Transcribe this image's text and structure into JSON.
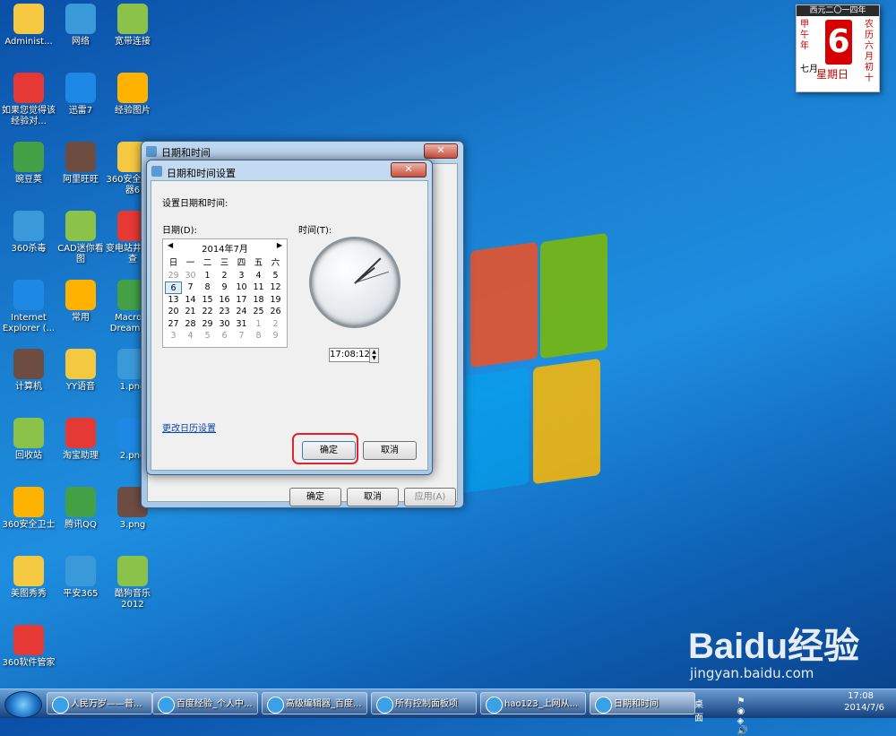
{
  "desktop": {
    "icons": [
      {
        "label": "Administ...",
        "icon": "user-folder-icon"
      },
      {
        "label": "网络",
        "icon": "network-icon"
      },
      {
        "label": "宽带连接",
        "icon": "broadband-icon"
      },
      {
        "label": "如果您觉得该经验对...",
        "icon": "document-icon"
      },
      {
        "label": "迅雷7",
        "icon": "thunder-icon"
      },
      {
        "label": "经验图片",
        "icon": "folder-icon"
      },
      {
        "label": "豌豆荚",
        "icon": "wandoujia-icon"
      },
      {
        "label": "阿里旺旺",
        "icon": "aliwangwang-icon"
      },
      {
        "label": "360安全浏览器6",
        "icon": "360-browser-icon"
      },
      {
        "label": "360杀毒",
        "icon": "360-antivirus-icon"
      },
      {
        "label": "CAD迷你看图",
        "icon": "cad-viewer-icon"
      },
      {
        "label": "变电站井前检查",
        "icon": "winrar-icon"
      },
      {
        "label": "Internet Explorer (...",
        "icon": "ie-icon"
      },
      {
        "label": "常用",
        "icon": "folder-icon"
      },
      {
        "label": "Macrom Dreamw...",
        "icon": "dreamweaver-icon"
      },
      {
        "label": "计算机",
        "icon": "computer-icon"
      },
      {
        "label": "YY语音",
        "icon": "yy-icon"
      },
      {
        "label": "1.png",
        "icon": "image-file-icon"
      },
      {
        "label": "回收站",
        "icon": "recycle-bin-icon"
      },
      {
        "label": "淘宝助理",
        "icon": "taobao-icon"
      },
      {
        "label": "2.png",
        "icon": "image-file-icon"
      },
      {
        "label": "360安全卫士",
        "icon": "360-safe-icon"
      },
      {
        "label": "腾讯QQ",
        "icon": "qq-icon"
      },
      {
        "label": "3.png",
        "icon": "image-file-icon"
      },
      {
        "label": "美图秀秀",
        "icon": "meitu-icon"
      },
      {
        "label": "平安365",
        "icon": "folder-icon"
      },
      {
        "label": "酷狗音乐 2012",
        "icon": "kugou-icon"
      },
      {
        "label": "360软件管家",
        "icon": "360-software-icon"
      }
    ]
  },
  "calendar_widget": {
    "top": "西元二〇一四年",
    "day": "6",
    "left_text": "甲午年",
    "right_text": "农历六月初十",
    "month": "七月",
    "weekday": "星期日"
  },
  "outer_window": {
    "title": "日期和时间",
    "ok": "确定",
    "cancel": "取消",
    "apply": "应用(A)"
  },
  "inner_window": {
    "title": "日期和时间设置",
    "instruction": "设置日期和时间:",
    "date_label": "日期(D):",
    "time_label": "时间(T):",
    "month_header": "2014年7月",
    "weekdays": [
      "日",
      "一",
      "二",
      "三",
      "四",
      "五",
      "六"
    ],
    "weeks": [
      [
        "29",
        "30",
        "1",
        "2",
        "3",
        "4",
        "5"
      ],
      [
        "6",
        "7",
        "8",
        "9",
        "10",
        "11",
        "12"
      ],
      [
        "13",
        "14",
        "15",
        "16",
        "17",
        "18",
        "19"
      ],
      [
        "20",
        "21",
        "22",
        "23",
        "24",
        "25",
        "26"
      ],
      [
        "27",
        "28",
        "29",
        "30",
        "31",
        "1",
        "2"
      ],
      [
        "3",
        "4",
        "5",
        "6",
        "7",
        "8",
        "9"
      ]
    ],
    "selected_day": "6",
    "time_value": "17:08:12",
    "change_calendar_link": "更改日历设置",
    "ok": "确定",
    "cancel": "取消"
  },
  "taskbar": {
    "items": [
      {
        "label": "人民万岁——普..."
      },
      {
        "label": "百度经验_个人中..."
      },
      {
        "label": "高级编辑器_百度..."
      },
      {
        "label": "所有控制面板项"
      },
      {
        "label": "hao123_上网从..."
      },
      {
        "label": "日期和时间"
      }
    ],
    "desktop_label": "桌面",
    "time": "17:08",
    "date": "2014/7/6"
  },
  "watermark": {
    "brand": "Baidu经验",
    "url": "jingyan.baidu.com"
  },
  "colors": {
    "accent": "#e0242b",
    "desktop": "#1a7fd0"
  }
}
